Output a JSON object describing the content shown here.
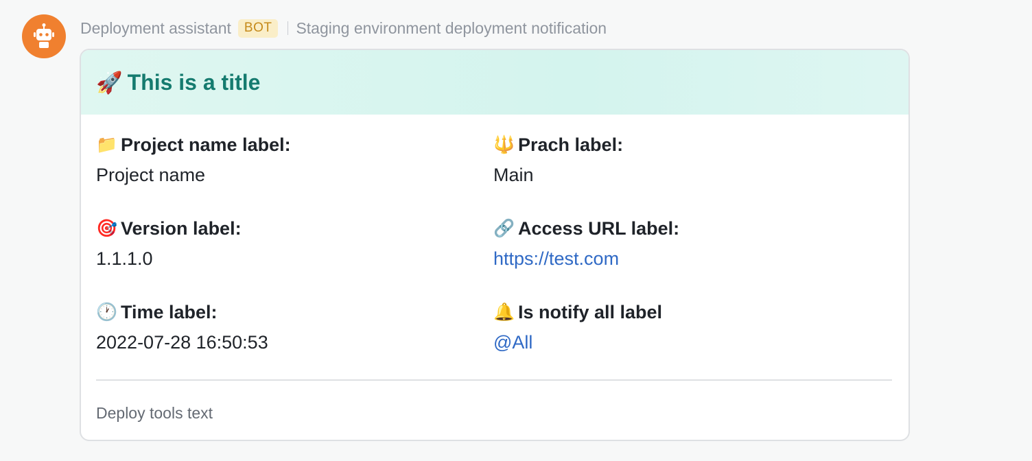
{
  "message": {
    "sender": "Deployment assistant",
    "badge": "BOT",
    "subtitle": "Staging environment deployment notification"
  },
  "card": {
    "title_icon": "rocket-icon",
    "title_emoji": "🚀",
    "title": "This is a title",
    "header_color": "#d4f4ee",
    "title_color": "#157b6f",
    "fields": [
      {
        "icon": "folder-icon",
        "emoji": "📁",
        "label": "Project name label:",
        "value": "Project name"
      },
      {
        "icon": "trident-icon",
        "emoji": "🔱",
        "label": "Prach label:",
        "value": "Main"
      },
      {
        "icon": "target-icon",
        "emoji": "🎯",
        "label": "Version label:",
        "value": "1.1.1.0"
      },
      {
        "icon": "link-icon",
        "emoji": "🔗",
        "label": "Access URL label:",
        "value": "https://test.com"
      },
      {
        "icon": "clock-icon",
        "emoji": "🕐",
        "label": "Time label:",
        "value": "2022-07-28 16:50:53"
      },
      {
        "icon": "bell-icon",
        "emoji": "🔔",
        "label": "Is notify all label",
        "value": "@All"
      }
    ],
    "footer": "Deploy tools text",
    "link_color": "#2f69c5"
  },
  "avatar": {
    "icon": "robot-icon",
    "color": "#f0802f"
  }
}
